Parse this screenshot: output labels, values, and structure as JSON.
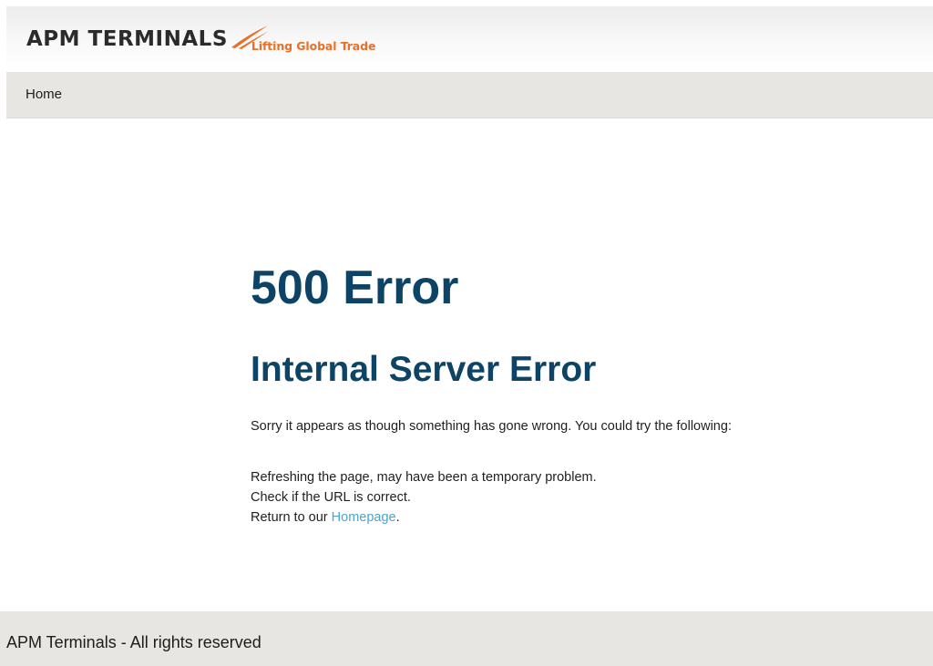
{
  "header": {
    "logo_text": "APM TERMINALS",
    "tagline": "Lifting Global Trade",
    "accent_color": "#e8702a"
  },
  "nav": {
    "items": [
      {
        "label": "Home"
      }
    ]
  },
  "main": {
    "error_code": "500 Error",
    "error_title": "Internal Server Error",
    "intro": "Sorry it appears as though something has gone wrong. You could try the following:",
    "suggestions": [
      {
        "text": "Refreshing the page, may have been a temporary problem."
      },
      {
        "text": "Check if the URL is correct."
      },
      {
        "prefix": "Return to our ",
        "link_label": "Homepage",
        "suffix": "."
      }
    ],
    "heading_color": "#0d4466",
    "link_color": "#4aa5c8"
  },
  "footer": {
    "text": "APM Terminals - All rights reserved"
  }
}
